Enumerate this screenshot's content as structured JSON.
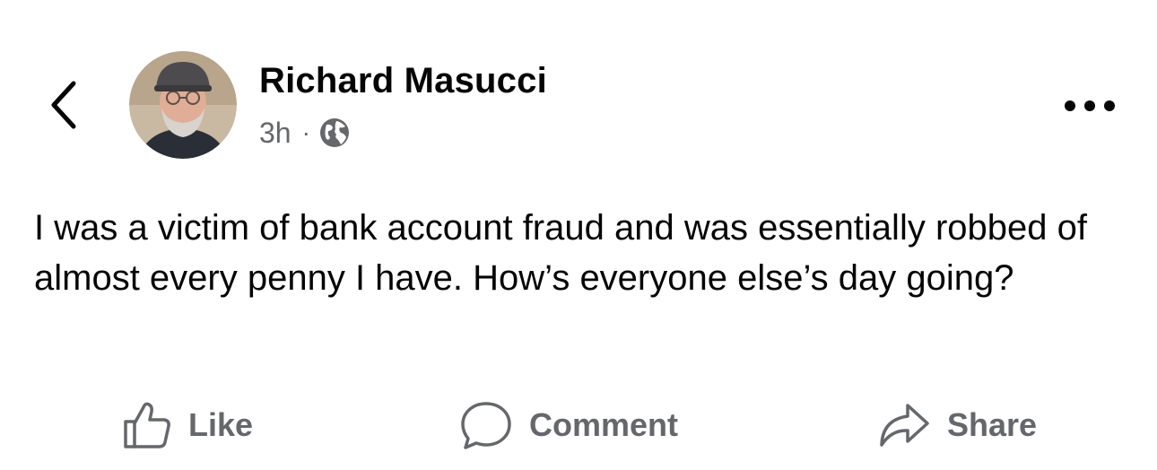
{
  "header": {
    "back_icon": "chevron-left-icon",
    "avatar_icon": "profile-photo",
    "author_name": "Richard Masucci",
    "timestamp": "3h",
    "separator": "·",
    "audience_icon": "globe-icon",
    "more_icon": "more-horizontal-icon"
  },
  "post": {
    "text": "I was a victim of bank account fraud and was essentially robbed of almost every penny I have. How’s everyone else’s day going?"
  },
  "actions": {
    "like_label": "Like",
    "like_icon": "thumbs-up-icon",
    "comment_label": "Comment",
    "comment_icon": "speech-bubble-icon",
    "share_label": "Share",
    "share_icon": "share-arrow-icon"
  },
  "colors": {
    "text_primary": "#050505",
    "text_secondary": "#65676b",
    "background": "#ffffff"
  }
}
